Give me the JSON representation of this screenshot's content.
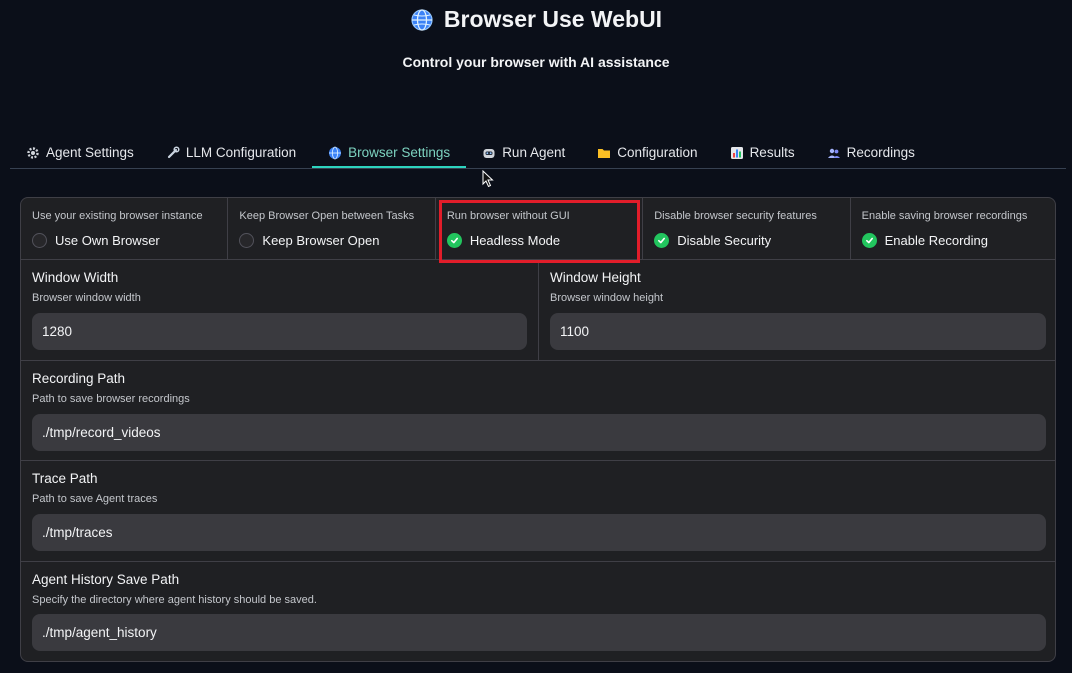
{
  "header": {
    "title": "Browser Use WebUI",
    "subtitle": "Control your browser with AI assistance",
    "icon": "globe-icon"
  },
  "tabs": [
    {
      "label": "Agent Settings",
      "icon": "gear-icon"
    },
    {
      "label": "LLM Configuration",
      "icon": "wrench-icon"
    },
    {
      "label": "Browser Settings",
      "icon": "globe-icon",
      "active": true
    },
    {
      "label": "Run Agent",
      "icon": "robot-icon"
    },
    {
      "label": "Configuration",
      "icon": "folder-icon"
    },
    {
      "label": "Results",
      "icon": "bar-chart-icon"
    },
    {
      "label": "Recordings",
      "icon": "people-icon"
    }
  ],
  "checkboxes": [
    {
      "info": "Use your existing browser instance",
      "label": "Use Own Browser",
      "checked": false
    },
    {
      "info": "Keep Browser Open between Tasks",
      "label": "Keep Browser Open",
      "checked": false
    },
    {
      "info": "Run browser without GUI",
      "label": "Headless Mode",
      "checked": true
    },
    {
      "info": "Disable browser security features",
      "label": "Disable Security",
      "checked": true
    },
    {
      "info": "Enable saving browser recordings",
      "label": "Enable Recording",
      "checked": true
    }
  ],
  "window_width": {
    "label": "Window Width",
    "info": "Browser window width",
    "value": "1280"
  },
  "window_height": {
    "label": "Window Height",
    "info": "Browser window height",
    "value": "1100"
  },
  "recording_path": {
    "label": "Recording Path",
    "info": "Path to save browser recordings",
    "value": "./tmp/record_videos"
  },
  "trace_path": {
    "label": "Trace Path",
    "info": "Path to save Agent traces",
    "value": "./tmp/traces"
  },
  "history_path": {
    "label": "Agent History Save Path",
    "info": "Specify the directory where agent history should be saved.",
    "value": "./tmp/agent_history"
  },
  "colors": {
    "accent": "#2dd4bf",
    "checked": "#22c55e",
    "highlight": "#e11d2a",
    "background": "#0b0f19"
  }
}
